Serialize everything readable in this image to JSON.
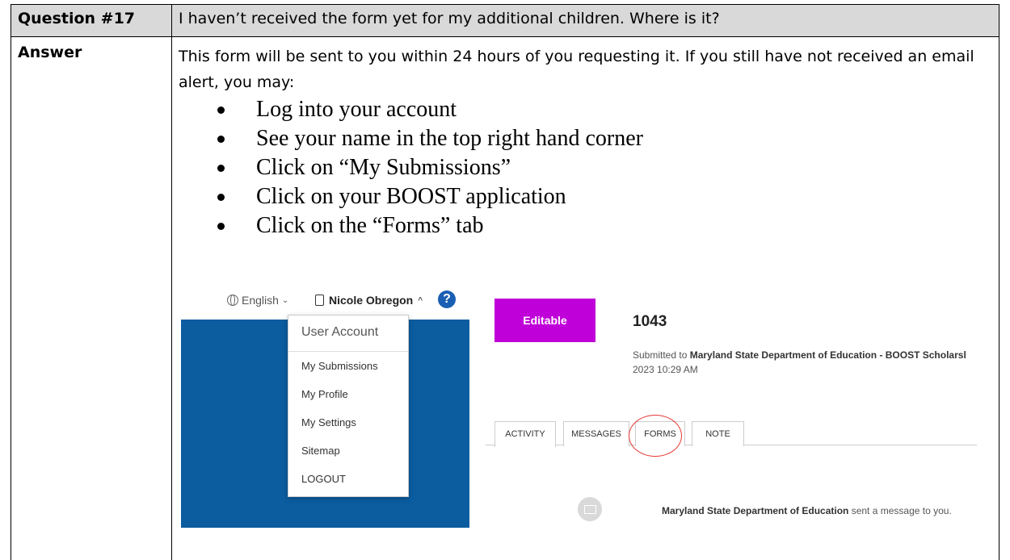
{
  "question": {
    "label": "Question #17",
    "text": "I haven’t received the form yet for my additional children. Where is it?"
  },
  "answer": {
    "label": "Answer",
    "text": "This form will be sent to you within 24 hours of you requesting it. If you still have not received an email alert, you may:",
    "steps": [
      "Log into your account",
      "See your name in the top right hand corner",
      "Click on “My Submissions”",
      "Click on your BOOST application",
      "Click on the “Forms” tab"
    ]
  },
  "screenshot_account": {
    "language": "English",
    "user_name": "Nicole Obregon",
    "help_glyph": "?",
    "menu_title": "User Account",
    "menu_items": [
      "My Submissions",
      "My Profile",
      "My Settings",
      "Sitemap",
      "LOGOUT"
    ],
    "header_blue": "#0b5da0"
  },
  "screenshot_submission": {
    "status_button": "Editable",
    "status_color": "#c000d8",
    "submission_number": "1043",
    "submitted_prefix": "Submitted to ",
    "organization": "Maryland State Department of Education - BOOST Scholarsl",
    "submitted_time": "2023 10:29 AM",
    "tabs": [
      "ACTIVITY",
      "MESSAGES",
      "FORMS",
      "NOTE"
    ],
    "highlighted_tab": "FORMS",
    "message_org": "Maryland State Department of Education",
    "message_suffix": " sent a message to you."
  }
}
